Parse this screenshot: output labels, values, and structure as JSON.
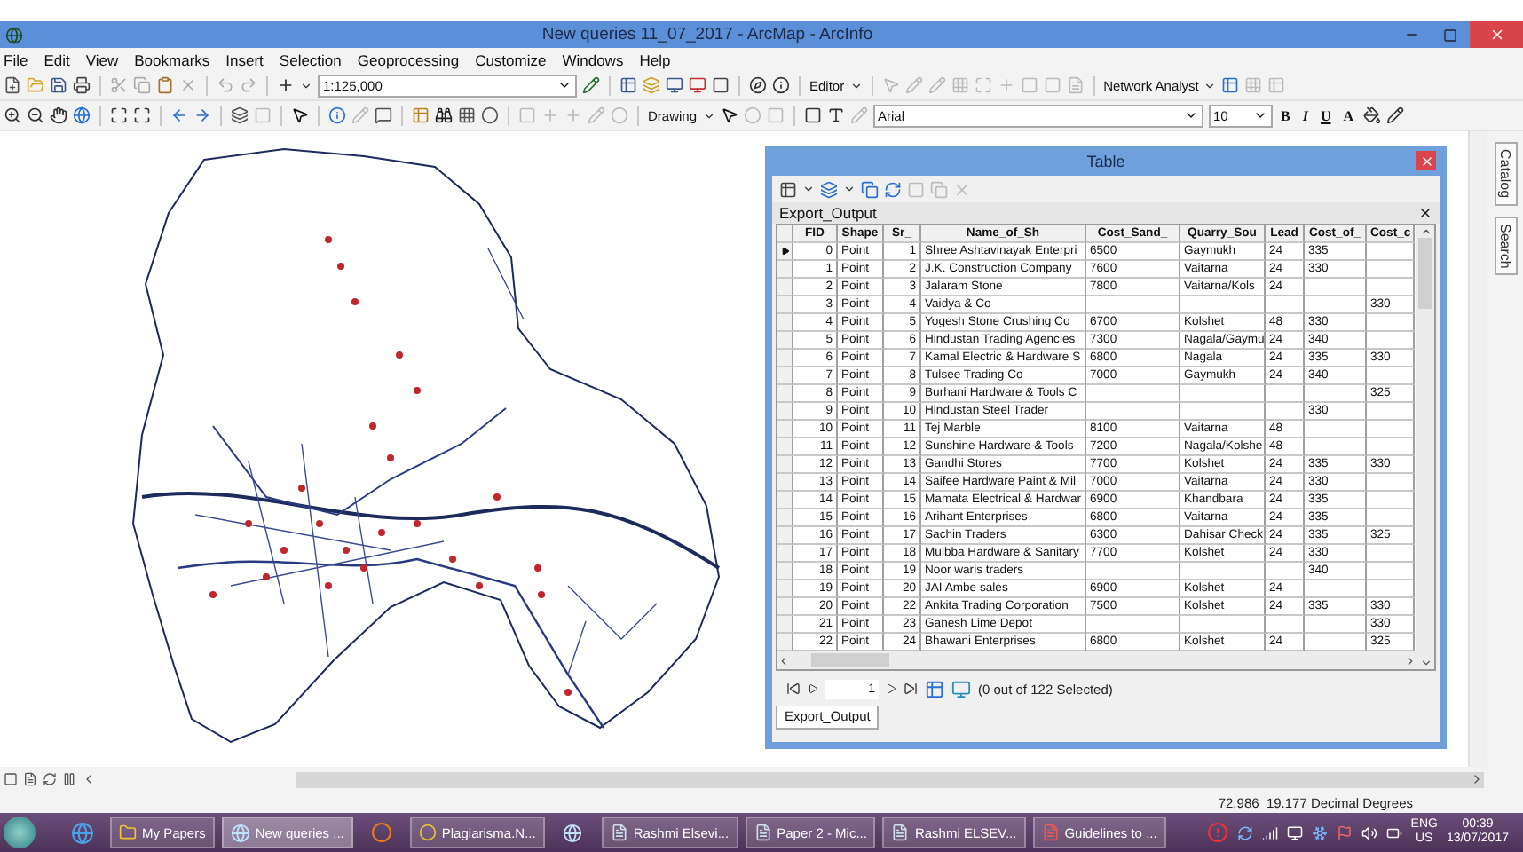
{
  "window": {
    "title": "New queries 11_07_2017 - ArcMap - ArcInfo"
  },
  "menu": [
    "File",
    "Edit",
    "View",
    "Bookmarks",
    "Insert",
    "Selection",
    "Geoprocessing",
    "Customize",
    "Windows",
    "Help"
  ],
  "toolbar": {
    "scale": "1:125,000",
    "editor": "Editor",
    "network_analyst": "Network Analyst",
    "drawing": "Drawing",
    "font": "Arial",
    "font_size": "10",
    "format_buttons": [
      "B",
      "I",
      "U",
      "A"
    ]
  },
  "table_window": {
    "title": "Table",
    "layer": "Export_Output",
    "columns": [
      "FID",
      "Shape",
      "Sr_",
      "Name_of_Sh",
      "Cost_Sand_",
      "Quarry_Sou",
      "Lead",
      "Cost_of_",
      "Cost_c"
    ],
    "rows": [
      {
        "current": true,
        "cells": [
          "0",
          "Point",
          "1",
          "Shree Ashtavinayak Enterpri",
          "6500",
          "Gaymukh",
          "24",
          "335",
          ""
        ]
      },
      {
        "current": false,
        "cells": [
          "1",
          "Point",
          "2",
          "J.K. Construction Company",
          "7600",
          "Vaitarna",
          "24",
          "330",
          ""
        ]
      },
      {
        "current": false,
        "cells": [
          "2",
          "Point",
          "3",
          "Jalaram Stone",
          "7800",
          "Vaitarna/Kols",
          "24",
          "",
          ""
        ]
      },
      {
        "current": false,
        "cells": [
          "3",
          "Point",
          "4",
          "Vaidya & Co",
          "",
          "",
          "",
          "",
          "330"
        ]
      },
      {
        "current": false,
        "cells": [
          "4",
          "Point",
          "5",
          "Yogesh Stone Crushing Co",
          "6700",
          "Kolshet",
          "48",
          "330",
          ""
        ]
      },
      {
        "current": false,
        "cells": [
          "5",
          "Point",
          "6",
          "Hindustan Trading Agencies",
          "7300",
          "Nagala/Gaymu",
          "24",
          "340",
          ""
        ]
      },
      {
        "current": false,
        "cells": [
          "6",
          "Point",
          "7",
          "Kamal Electric & Hardware S",
          "6800",
          "Nagala",
          "24",
          "335",
          "330"
        ]
      },
      {
        "current": false,
        "cells": [
          "7",
          "Point",
          "8",
          "Tulsee Trading Co",
          "7000",
          "Gaymukh",
          "24",
          "340",
          ""
        ]
      },
      {
        "current": false,
        "cells": [
          "8",
          "Point",
          "9",
          "Burhani Hardware & Tools C",
          "",
          "",
          "",
          "",
          "325"
        ]
      },
      {
        "current": false,
        "cells": [
          "9",
          "Point",
          "10",
          "Hindustan Steel Trader",
          "",
          "",
          "",
          "330",
          ""
        ]
      },
      {
        "current": false,
        "cells": [
          "10",
          "Point",
          "11",
          "Tej Marble",
          "8100",
          "Vaitarna",
          "48",
          "",
          ""
        ]
      },
      {
        "current": false,
        "cells": [
          "11",
          "Point",
          "12",
          "Sunshine Hardware & Tools",
          "7200",
          "Nagala/Kolshe",
          "48",
          "",
          ""
        ]
      },
      {
        "current": false,
        "cells": [
          "12",
          "Point",
          "13",
          "Gandhi Stores",
          "7700",
          "Kolshet",
          "24",
          "335",
          "330"
        ]
      },
      {
        "current": false,
        "cells": [
          "13",
          "Point",
          "14",
          "Saifee Hardware Paint & Mil",
          "7000",
          "Vaitarna",
          "24",
          "330",
          ""
        ]
      },
      {
        "current": false,
        "cells": [
          "14",
          "Point",
          "15",
          "Mamata Electrical & Hardwar",
          "6900",
          "Khandbara",
          "24",
          "335",
          ""
        ]
      },
      {
        "current": false,
        "cells": [
          "15",
          "Point",
          "16",
          "Arihant Enterprises",
          "6800",
          "Vaitarna",
          "24",
          "335",
          ""
        ]
      },
      {
        "current": false,
        "cells": [
          "16",
          "Point",
          "17",
          "Sachin Traders",
          "6300",
          "Dahisar Check",
          "24",
          "335",
          "325"
        ]
      },
      {
        "current": false,
        "cells": [
          "17",
          "Point",
          "18",
          "Mulbba Hardware & Sanitary",
          "7700",
          "Kolshet",
          "24",
          "330",
          ""
        ]
      },
      {
        "current": false,
        "cells": [
          "18",
          "Point",
          "19",
          "Noor waris traders",
          "",
          "",
          "",
          "340",
          ""
        ]
      },
      {
        "current": false,
        "cells": [
          "19",
          "Point",
          "20",
          "JAI Ambe sales",
          "6900",
          "Kolshet",
          "24",
          "",
          ""
        ]
      },
      {
        "current": false,
        "cells": [
          "20",
          "Point",
          "22",
          "Ankita Trading Corporation",
          "7500",
          "Kolshet",
          "24",
          "335",
          "330"
        ]
      },
      {
        "current": false,
        "cells": [
          "21",
          "Point",
          "23",
          "Ganesh Lime Depot",
          "",
          "",
          "",
          "",
          "330"
        ]
      },
      {
        "current": false,
        "cells": [
          "22",
          "Point",
          "24",
          "Bhawani Enterprises",
          "6800",
          "Kolshet",
          "24",
          "",
          "325"
        ]
      }
    ],
    "record": "1",
    "selection_text": "(0 out of 122 Selected)",
    "tabs": [
      {
        "label": "Export_Output",
        "selected": true
      }
    ]
  },
  "dock_tabs": [
    "Catalog",
    "Search"
  ],
  "status_bar": {
    "coordinates": "72.986  19.177 Decimal Degrees"
  },
  "taskbar": {
    "items": [
      {
        "kind": "browser",
        "selected": false
      },
      {
        "kind": "folder",
        "label": "My Papers",
        "selected": false
      },
      {
        "kind": "globe",
        "label": "New queries ...",
        "selected": true
      },
      {
        "kind": "fox",
        "selected": false
      },
      {
        "kind": "chrome",
        "label": "Plagiarisma.N...",
        "selected": false
      },
      {
        "kind": "globe",
        "selected": false
      },
      {
        "kind": "doc",
        "label": "Rashmi Elsevi...",
        "selected": false
      },
      {
        "kind": "doc",
        "label": "Paper 2 - Mic...",
        "selected": false
      },
      {
        "kind": "doc",
        "label": "Rashmi ELSEV...",
        "selected": false
      },
      {
        "kind": "pdf",
        "label": "Guidelines to ...",
        "selected": false
      }
    ],
    "language": [
      "ENG",
      "US"
    ],
    "time": "00:39",
    "date": "13/07/2017"
  }
}
